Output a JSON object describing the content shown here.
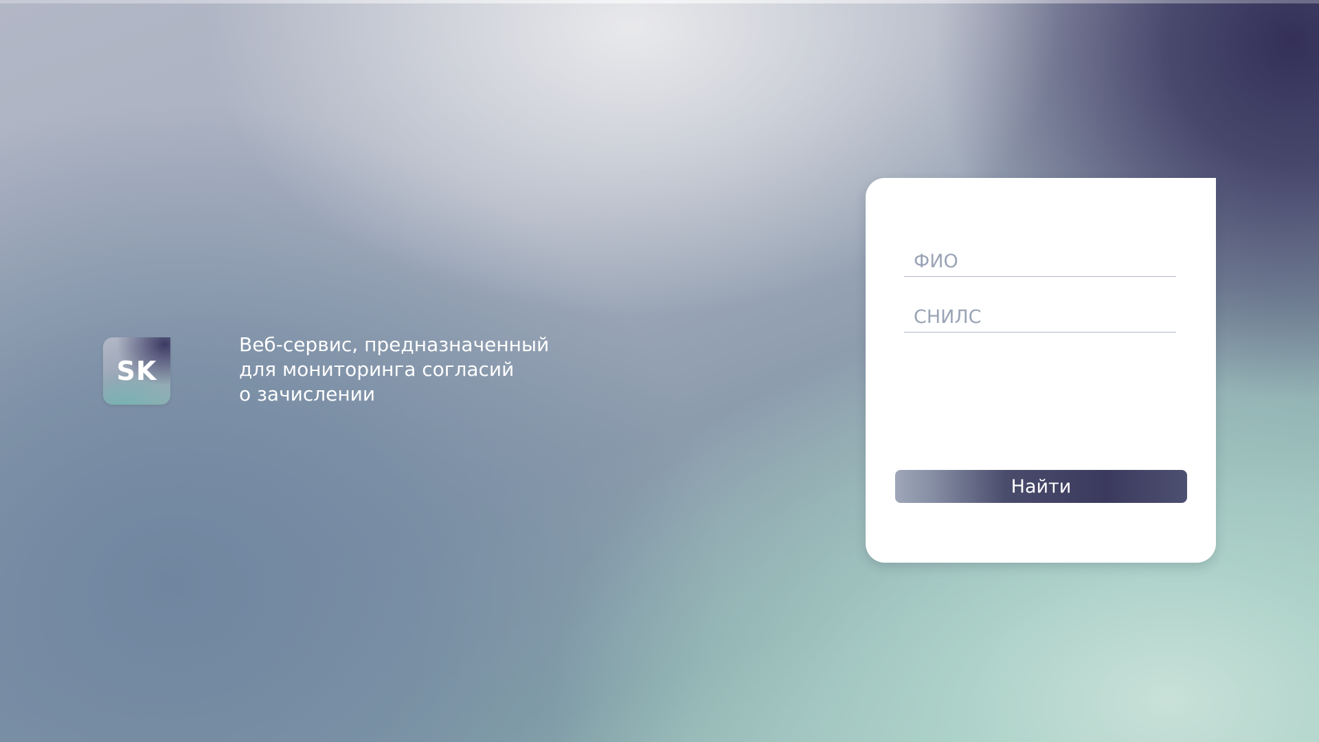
{
  "logo": {
    "text": "SK"
  },
  "tagline": {
    "lines": [
      "Веб-сервис, предназначенный",
      "для мониторинга согласий",
      "о зачислении"
    ]
  },
  "form": {
    "fio_placeholder": "ФИО",
    "fio_value": "",
    "snils_placeholder": "СНИЛС",
    "snils_value": "",
    "submit_label": "Найти"
  },
  "colors": {
    "button_dark": "#3b3a5e",
    "button_light": "#9ea6b8",
    "placeholder": "#9aa3b6",
    "underline": "#aeb6c6",
    "card_bg": "#ffffff"
  }
}
